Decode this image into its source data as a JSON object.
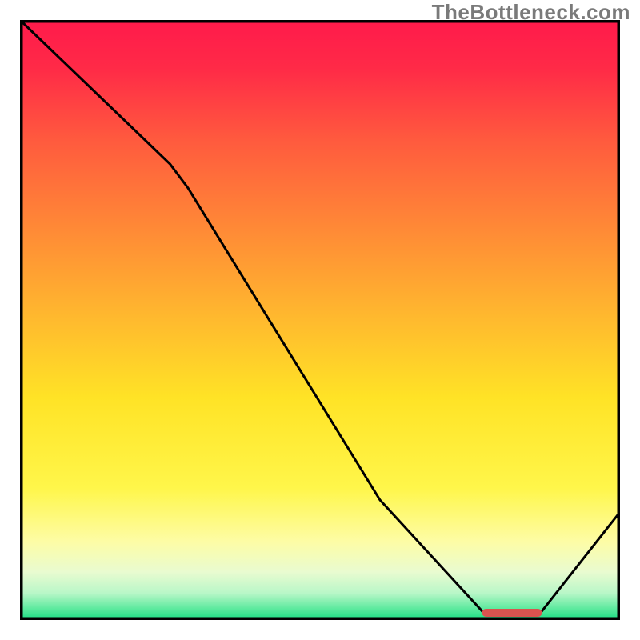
{
  "watermark": "TheBottleneck.com",
  "chart_data": {
    "type": "line",
    "title": "",
    "xlabel": "",
    "ylabel": "",
    "xlim": [
      0,
      100
    ],
    "ylim": [
      0,
      100
    ],
    "x": [
      0,
      25,
      28,
      60,
      77,
      83,
      87,
      100
    ],
    "values": [
      100,
      76,
      72,
      20,
      1.5,
      1.0,
      1.5,
      18
    ],
    "highlight_band": {
      "x_start": 77,
      "x_end": 87,
      "y": 1.2
    },
    "background_gradient": {
      "stops": [
        {
          "offset": 0.0,
          "color": "#ff1a4b"
        },
        {
          "offset": 0.08,
          "color": "#ff2a47"
        },
        {
          "offset": 0.2,
          "color": "#ff5a3e"
        },
        {
          "offset": 0.35,
          "color": "#ff8a36"
        },
        {
          "offset": 0.5,
          "color": "#ffba2e"
        },
        {
          "offset": 0.63,
          "color": "#ffe326"
        },
        {
          "offset": 0.78,
          "color": "#fff64a"
        },
        {
          "offset": 0.87,
          "color": "#fdfca6"
        },
        {
          "offset": 0.92,
          "color": "#e9fbd0"
        },
        {
          "offset": 0.955,
          "color": "#b9f7c8"
        },
        {
          "offset": 0.98,
          "color": "#61eaa0"
        },
        {
          "offset": 1.0,
          "color": "#17de82"
        }
      ]
    },
    "line_color": "#000000",
    "highlight_color": "#d9534f",
    "frame_color": "#000000"
  }
}
